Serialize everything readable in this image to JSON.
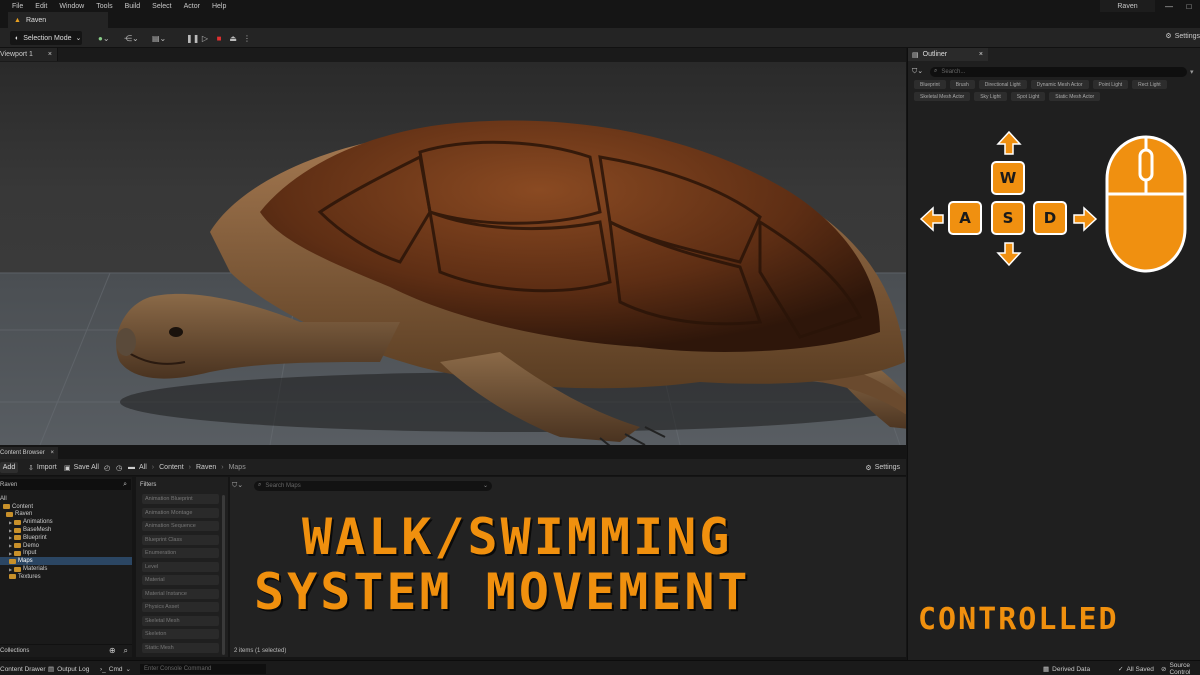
{
  "menubar": {
    "items": [
      "File",
      "Edit",
      "Window",
      "Tools",
      "Build",
      "Select",
      "Actor",
      "Help"
    ],
    "project_name": "Raven",
    "window_controls": [
      "—",
      "□"
    ]
  },
  "level_tab": {
    "label": "Raven"
  },
  "toolbar": {
    "selection_mode": "Selection Mode",
    "settings": "Settings"
  },
  "viewport": {
    "tab_label": "Viewport 1",
    "close": "×"
  },
  "outliner": {
    "tab_label": "Outliner",
    "close": "×",
    "search_placeholder": "Search...",
    "filter_chips": [
      "Blueprint",
      "Brush",
      "Directional Light",
      "Dynamic Mesh Actor",
      "Point Light",
      "Rect Light",
      "Skeletal Mesh Actor",
      "Sky Light",
      "Spot Light",
      "Static Mesh Actor"
    ]
  },
  "controls": {
    "keys": {
      "w": "W",
      "a": "A",
      "s": "S",
      "d": "D"
    },
    "accent_color": "#f09010"
  },
  "content_browser": {
    "tab_label": "Content Browser",
    "close": "×",
    "add": "Add",
    "import": "Import",
    "save_all": "Save All",
    "breadcrumb": [
      "All",
      "Content",
      "Raven",
      "Maps"
    ],
    "settings": "Settings",
    "tree_search_value": "Raven",
    "tree": [
      {
        "label": "All",
        "depth": 0,
        "folder": false,
        "arrow": false,
        "selected": false
      },
      {
        "label": "Content",
        "depth": 1,
        "folder": true,
        "arrow": false,
        "selected": false
      },
      {
        "label": "Raven",
        "depth": 2,
        "folder": true,
        "arrow": false,
        "selected": false
      },
      {
        "label": "Animations",
        "depth": 3,
        "folder": true,
        "arrow": true,
        "selected": false
      },
      {
        "label": "BaseMesh",
        "depth": 3,
        "folder": true,
        "arrow": true,
        "selected": false
      },
      {
        "label": "Blueprint",
        "depth": 3,
        "folder": true,
        "arrow": true,
        "selected": false
      },
      {
        "label": "Demo",
        "depth": 3,
        "folder": true,
        "arrow": true,
        "selected": false
      },
      {
        "label": "Input",
        "depth": 3,
        "folder": true,
        "arrow": true,
        "selected": false
      },
      {
        "label": "Maps",
        "depth": 3,
        "folder": true,
        "arrow": false,
        "selected": true
      },
      {
        "label": "Materials",
        "depth": 3,
        "folder": true,
        "arrow": true,
        "selected": false
      },
      {
        "label": "Textures",
        "depth": 3,
        "folder": true,
        "arrow": false,
        "selected": false
      }
    ],
    "filters_header": "Filters",
    "filters": [
      "Animation Blueprint",
      "Animation Montage",
      "Animation Sequence",
      "Blueprint Class",
      "Enumeration",
      "Level",
      "Material",
      "Material Instance",
      "Physics Asset",
      "Skeletal Mesh",
      "Skeleton",
      "Static Mesh"
    ],
    "asset_search_placeholder": "Search Maps",
    "items_count": "2 items (1 selected)",
    "collections": "Collections"
  },
  "title": {
    "line1": "WALK/SWIMMING",
    "line2": "SYSTEM MOVEMENT",
    "controlled": "CONTROLLED"
  },
  "statusbar": {
    "content_drawer": "Content Drawer",
    "output_log": "Output Log",
    "cmd": "Cmd",
    "console_placeholder": "Enter Console Command",
    "derived_data": "Derived Data",
    "all_saved": "All Saved",
    "source_control": "Source Control"
  }
}
